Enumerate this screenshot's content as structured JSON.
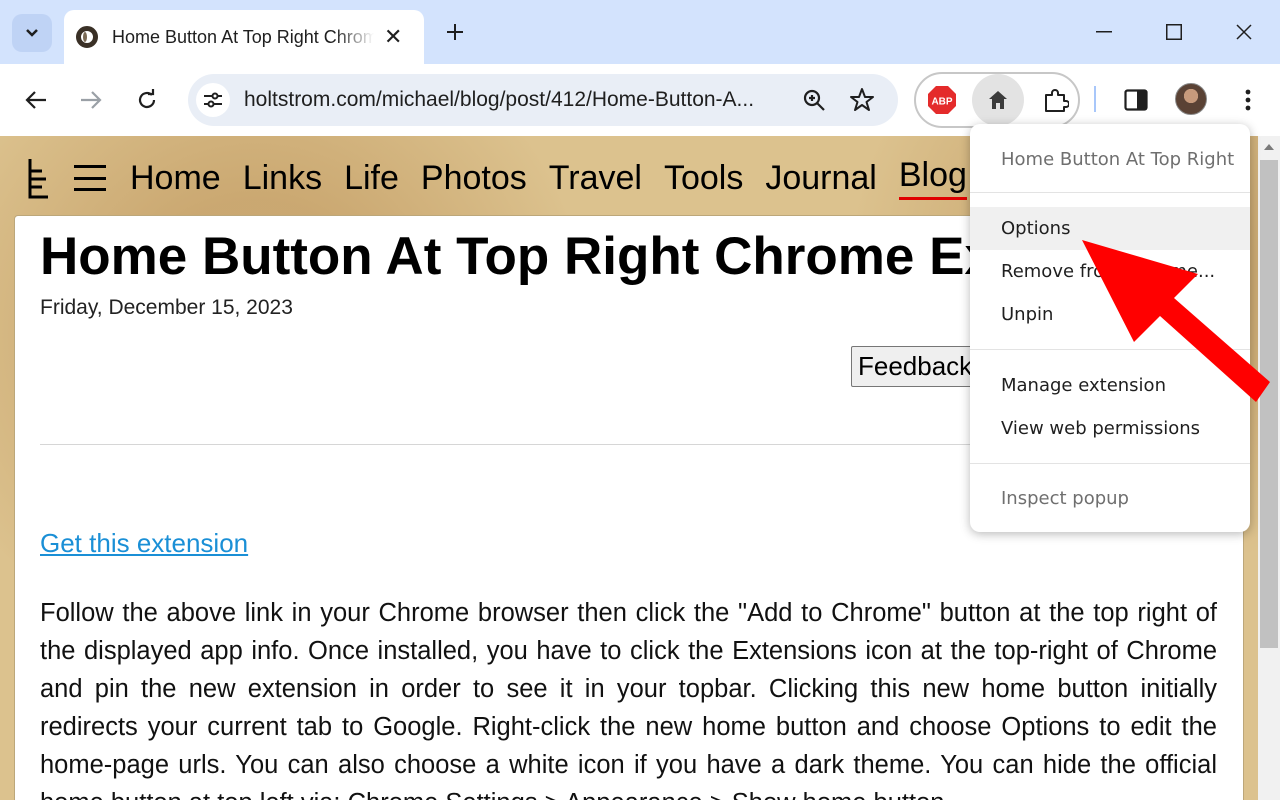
{
  "browser": {
    "tab": {
      "title": "Home Button At Top Right Chrome Extension"
    },
    "url": "holtstrom.com/michael/blog/post/412/Home-Button-A...",
    "extensions": {
      "adblock_label": "ABP"
    }
  },
  "site": {
    "nav": [
      "Home",
      "Links",
      "Life",
      "Photos",
      "Travel",
      "Tools",
      "Journal",
      "Blog"
    ],
    "active_nav": "Blog"
  },
  "post": {
    "title": "Home Button At Top Right Chrome Extension",
    "date": "Friday, December 15, 2023",
    "feedback_label": "Feedback",
    "link_text": "Get this extension",
    "body": "Follow the above link in your Chrome browser then click the \"Add to Chrome\" button at the top right of the displayed app info. Once installed, you have to click the Extensions icon at the top-right of Chrome and pin the new extension in order to see it in your topbar. Clicking this new home button initially redirects your current tab to Google. Right-click the new home button and choose Options to edit the home-page urls. You can also choose a white icon if you have a dark theme. You can hide the official home button at top left via: Chrome Settings > Appearance > Show home button."
  },
  "context_menu": {
    "header": "Home Button At Top Right",
    "options": "Options",
    "remove": "Remove from Chrome...",
    "unpin": "Unpin",
    "manage": "Manage extension",
    "permissions": "View web permissions",
    "inspect": "Inspect popup"
  },
  "colors": {
    "tabstrip": "#d3e3fd",
    "link": "#1a8fd6",
    "arrow": "#ff0000",
    "active_underline": "#e00000"
  }
}
